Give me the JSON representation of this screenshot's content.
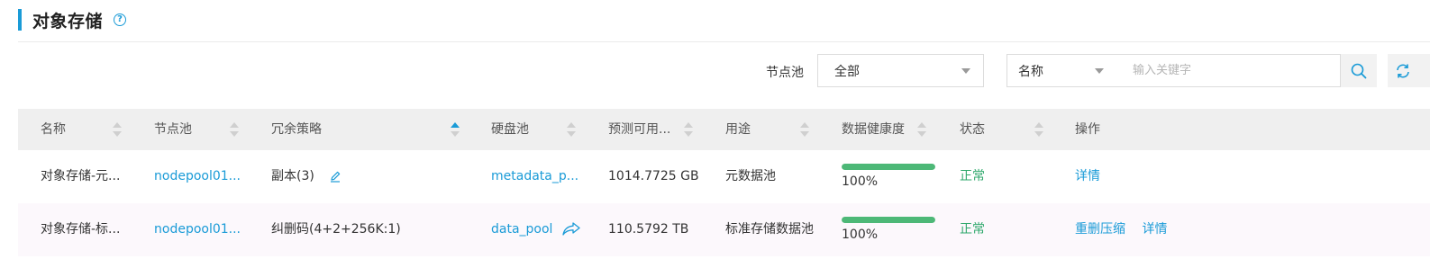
{
  "header": {
    "title": "对象存储",
    "help_glyph": "?"
  },
  "filters": {
    "pool_label": "节点池",
    "pool_value": "全部",
    "field_value": "名称",
    "search_placeholder": "输入关键字"
  },
  "icons": {
    "search": "search-icon",
    "refresh": "refresh-icon",
    "edit": "edit-icon",
    "share": "share-icon"
  },
  "colors": {
    "accent": "#1a9bd7",
    "ok": "#2ea86b",
    "health": "#4db877",
    "header_bg": "#efefef"
  },
  "table": {
    "columns": [
      "名称",
      "节点池",
      "冗余策略",
      "硬盘池",
      "预测可用...",
      "用途",
      "数据健康度",
      "状态",
      "操作"
    ],
    "rows": [
      {
        "name": "对象存储-元...",
        "node_pool": "nodepool01...",
        "redundancy": "副本(3)",
        "disk_pool": "metadata_p...",
        "available": "1014.7725 GB",
        "usage": "元数据池",
        "health": "100%",
        "health_value": 100,
        "status": "正常",
        "actions": [
          "详情"
        ]
      },
      {
        "name": "对象存储-标...",
        "node_pool": "nodepool01...",
        "redundancy": "纠删码(4+2+256K:1)",
        "disk_pool": "data_pool",
        "available": "110.5792 TB",
        "usage": "标准存储数据池",
        "health": "100%",
        "health_value": 100,
        "status": "正常",
        "actions": [
          "重删压缩",
          "详情"
        ]
      }
    ]
  }
}
